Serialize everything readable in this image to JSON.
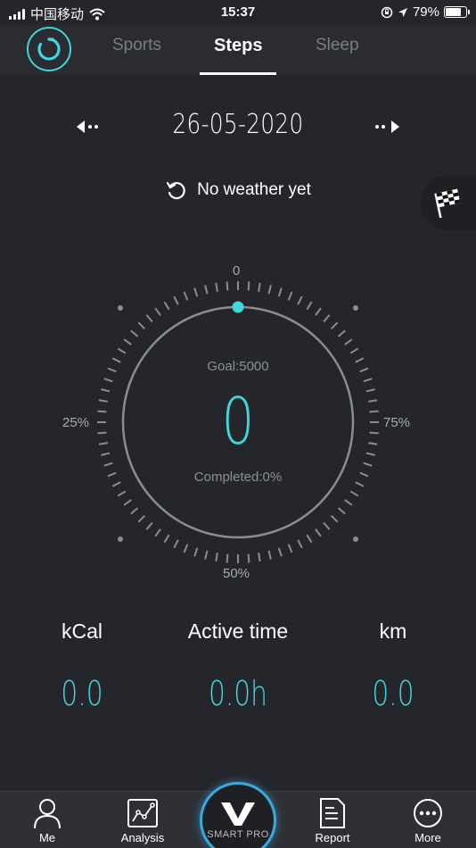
{
  "status_bar": {
    "carrier": "中国移动",
    "time": "15:37",
    "battery": "79%",
    "battery_level": 0.79
  },
  "tabs": [
    {
      "label": "Sports"
    },
    {
      "label": "Steps"
    },
    {
      "label": "Sleep"
    }
  ],
  "date": "26-05-2020",
  "weather": "No weather yet",
  "dial": {
    "top_label": "0",
    "left_label": "25%",
    "right_label": "75%",
    "bottom_label": "50%",
    "goal": "Goal:5000",
    "steps": "0",
    "completed": "Completed:0%",
    "progress": 0
  },
  "stats": [
    {
      "label": "kCal",
      "value": "0.0"
    },
    {
      "label": "Active time",
      "value": "0.0h"
    },
    {
      "label": "km",
      "value": "0.0"
    }
  ],
  "bottom_nav": {
    "me": "Me",
    "analysis": "Analysis",
    "center_brand": "SMART PRO",
    "report": "Report",
    "more": "More"
  },
  "colors": {
    "accent": "#3fd6dc",
    "background": "#24262b",
    "center_ring": "#3aa9e0"
  },
  "icons": {
    "logo": "circular-refresh-logo-icon",
    "prev": "arrow-left-dots-icon",
    "next": "arrow-right-dots-icon",
    "refresh": "refresh-icon",
    "flag": "checkered-flag-icon",
    "me": "person-icon",
    "analysis": "line-chart-icon",
    "center": "v-logo-icon",
    "report": "document-icon",
    "more": "more-dots-icon"
  }
}
